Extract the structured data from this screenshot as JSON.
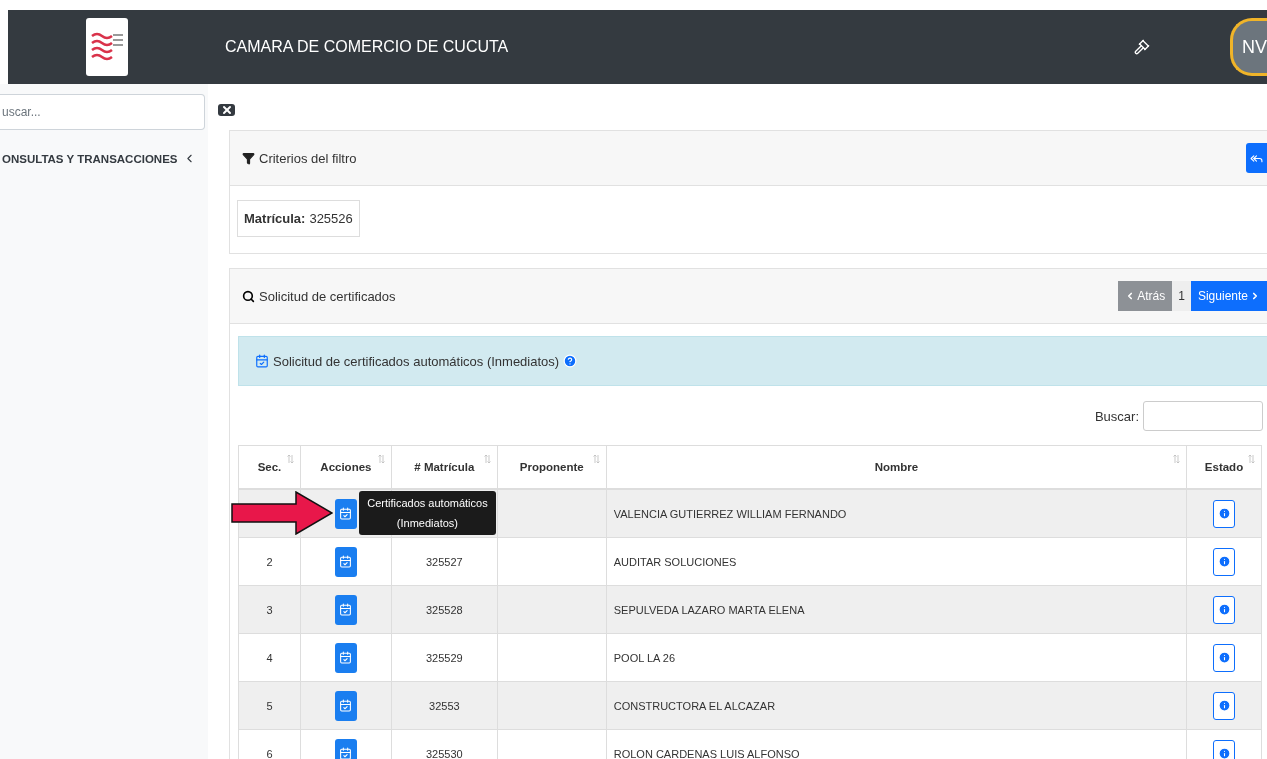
{
  "header": {
    "title": "CAMARA DE COMERCIO DE CUCUTA",
    "avatar": "NV"
  },
  "sidebar": {
    "search_placeholder": "uscar...",
    "menu": [
      {
        "label": "ONSULTAS Y TRANSACCIONES",
        "expanded": false
      }
    ]
  },
  "filter_panel": {
    "title": "Criterios del filtro",
    "criteria": [
      {
        "label": "Matrícula:",
        "value": "325526"
      }
    ]
  },
  "results_panel": {
    "title": "Solicitud de certificados",
    "pagination": {
      "prev": "Atrás",
      "page": "1",
      "next": "Siguiente",
      "prev_disabled": true
    },
    "alert": "Solicitud de certificados automáticos (Inmediatos)",
    "search_label": "Buscar:",
    "columns": [
      "Sec.",
      "Acciones",
      "# Matrícula",
      "Proponente",
      "Nombre",
      "Estado"
    ],
    "rows": [
      {
        "nombre": "VALENCIA GUTIERREZ WILLIAM FERNANDO"
      },
      {
        "sec": "2",
        "matricula": "325527",
        "nombre": "AUDITAR SOLUCIONES"
      },
      {
        "sec": "3",
        "matricula": "325528",
        "nombre": "SEPULVEDA LAZARO MARTA ELENA"
      },
      {
        "sec": "4",
        "matricula": "325529",
        "nombre": "POOL LA 26"
      },
      {
        "sec": "5",
        "matricula": "32553",
        "nombre": "CONSTRUCTORA EL ALCAZAR"
      },
      {
        "sec": "6",
        "matricula": "325530",
        "nombre": "ROLON CARDENAS LUIS ALFONSO"
      }
    ],
    "tooltip": "Certificados automáticos (Inmediatos)"
  }
}
